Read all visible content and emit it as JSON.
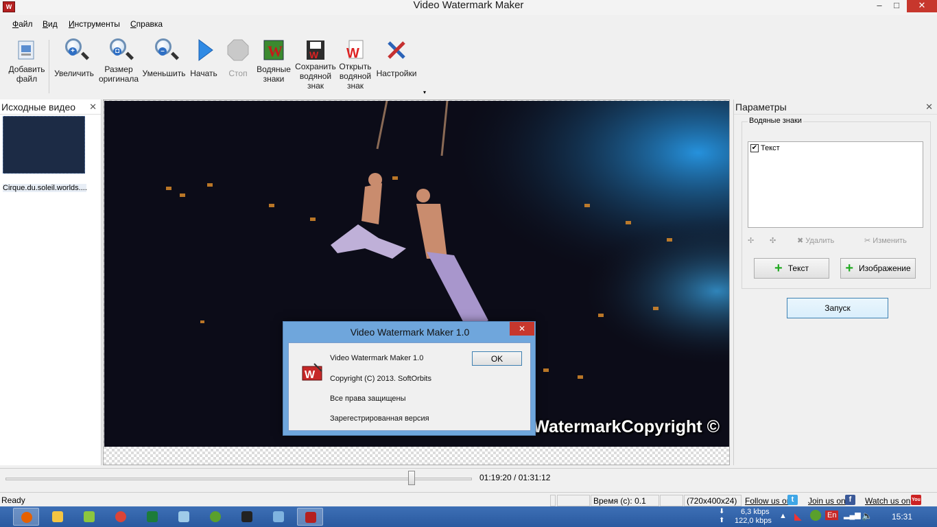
{
  "window": {
    "title": "Video Watermark Maker",
    "icon_text": "W",
    "min": "–",
    "max": "□",
    "close": "✕"
  },
  "menu": [
    "Файл",
    "Вид",
    "Инструменты",
    "Справка"
  ],
  "toolbar": {
    "add_file": "Добавить файл",
    "zoom_in": "Увеличить",
    "original_size": "Размер оригинала",
    "zoom_out": "Уменьшить",
    "start": "Начать",
    "stop": "Стоп",
    "watermarks": "Водяные знаки",
    "save_watermark": "Сохранить водяной знак",
    "open_watermark": "Открыть водяной знак",
    "settings": "Настройки",
    "more": "▾"
  },
  "source_panel": {
    "title": "Исходные видео",
    "close": "✕",
    "file_name": "Cirque.du.soleil.worlds...."
  },
  "video": {
    "watermark_text": "WatermarkCopyright ©"
  },
  "params_panel": {
    "title": "Параметры",
    "close": "✕",
    "group_label": "Водяные знаки",
    "items": [
      {
        "label": "Текст",
        "checked": true
      }
    ],
    "check_mark": "✔",
    "up": "✢",
    "down": "✣",
    "delete": "Удалить",
    "edit": "Изменить",
    "add_text": "Текст",
    "add_image": "Изображение",
    "plus": "+",
    "run": "Запуск"
  },
  "timeline": {
    "current": "01:19:20",
    "total": "01:31:12",
    "display": "01:19:20 / 01:31:12",
    "progress": 0.87
  },
  "status": {
    "ready": "Ready",
    "time": "Время (с): 0.1",
    "resolution": "(720x400x24)",
    "follow": "Follow us on",
    "join": "Join us on",
    "watch": "Watch us on",
    "twitter_icon": "t",
    "facebook_icon": "f",
    "youtube_icon": "You"
  },
  "dialog": {
    "title": "Video Watermark Maker 1.0",
    "close": "✕",
    "product": "Video Watermark Maker 1.0",
    "copyright": "Copyright (C) 2013. SoftOrbits",
    "rights": "Все права защищены",
    "registered": "Зарегестрированная версия",
    "ok": "OK"
  },
  "taskbar": {
    "download": "6,3 kbps",
    "upload": "122,0 kbps",
    "lang": "En",
    "clock": "15:31"
  }
}
